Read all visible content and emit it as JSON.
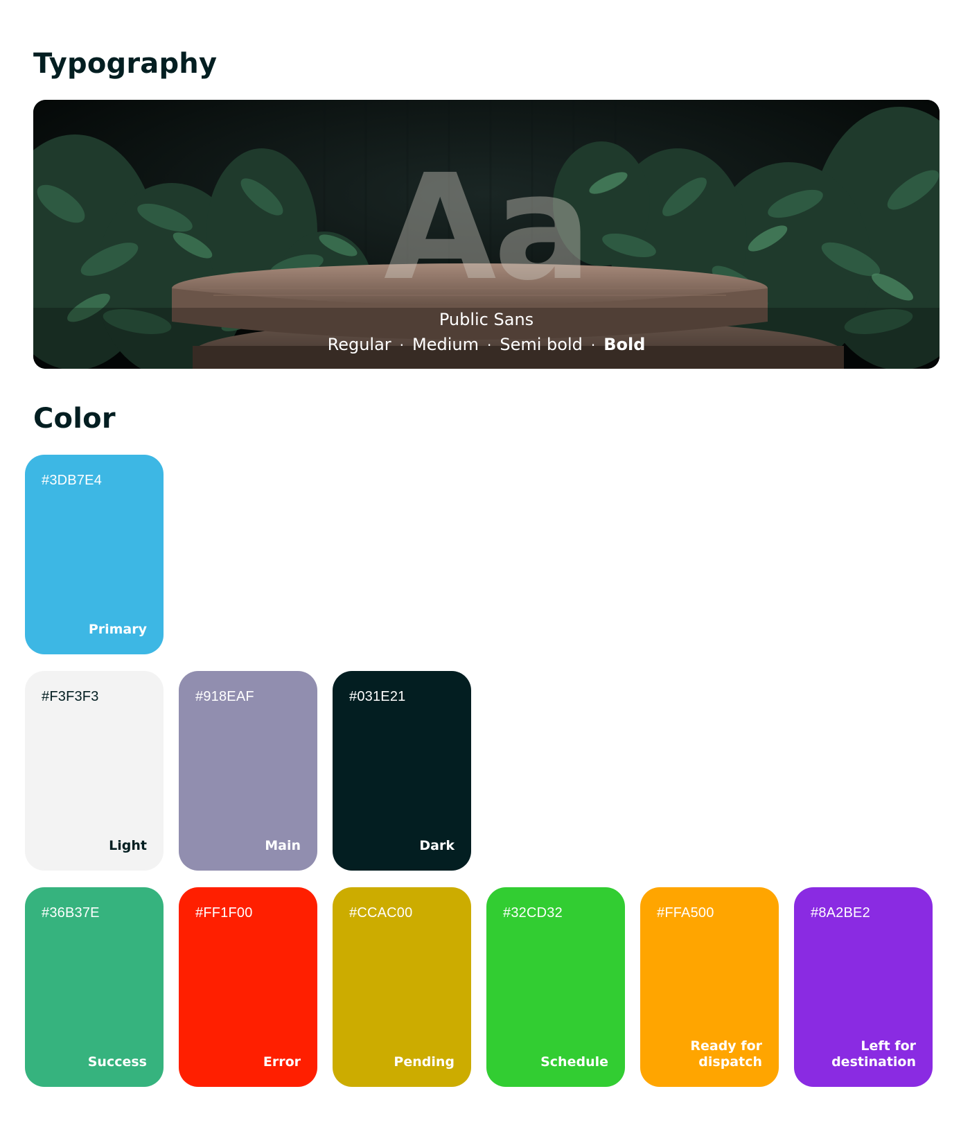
{
  "typography": {
    "section_title": "Typography",
    "specimen": "Aa",
    "font_name": "Public Sans",
    "weights": [
      "Regular",
      "Medium",
      "Semi bold",
      "Bold"
    ],
    "separator": "·"
  },
  "color": {
    "section_title": "Color",
    "swatches": [
      {
        "hex": "#3DB7E4",
        "name": "Primary",
        "text_color": "#ffffff"
      },
      {
        "hex": "#F3F3F3",
        "name": "Light",
        "text_color": "#031E21"
      },
      {
        "hex": "#918EAF",
        "name": "Main",
        "text_color": "#ffffff"
      },
      {
        "hex": "#031E21",
        "name": "Dark",
        "text_color": "#ffffff"
      },
      {
        "hex": "#36B37E",
        "name": "Success",
        "text_color": "#ffffff"
      },
      {
        "hex": "#FF1F00",
        "name": "Error",
        "text_color": "#ffffff"
      },
      {
        "hex": "#CCAC00",
        "name": "Pending",
        "text_color": "#ffffff"
      },
      {
        "hex": "#32CD32",
        "name": "Schedule",
        "text_color": "#ffffff"
      },
      {
        "hex": "#FFA500",
        "name": "Ready for dispatch",
        "text_color": "#ffffff"
      },
      {
        "hex": "#8A2BE2",
        "name": "Left for destination",
        "text_color": "#ffffff"
      }
    ]
  }
}
